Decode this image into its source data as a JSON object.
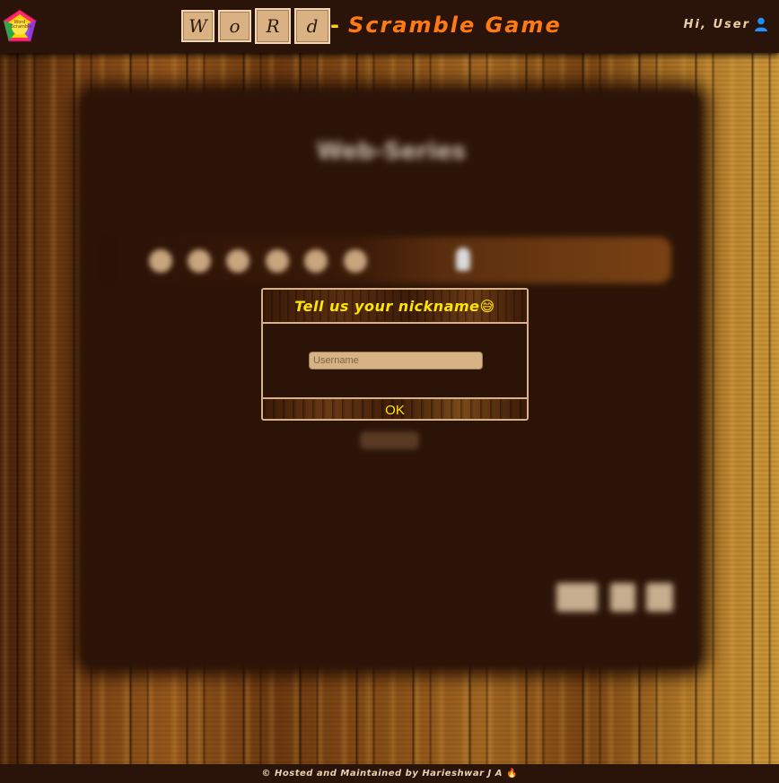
{
  "header": {
    "logo_text": "Word Scramble",
    "tiles": [
      "W",
      "o",
      "R",
      "d"
    ],
    "dash": "-",
    "title": "Scramble Game",
    "user_label": "Hi, User",
    "user_icon": "user-icon"
  },
  "game_panel": {
    "title": "Web-Series"
  },
  "modal": {
    "title": "Tell us your nickname😅",
    "username_placeholder": "Username",
    "ok_label": "OK"
  },
  "footer": {
    "text": "© Hosted and Maintained by Harieshwar J A",
    "flame_icon": "🔥"
  },
  "colors": {
    "header_bg": "#2a1308",
    "title_orange": "#ff7a10",
    "modal_title_yellow": "#ffe600",
    "tile_bg": "#d9b183",
    "user_icon_blue": "#1e90ff"
  }
}
